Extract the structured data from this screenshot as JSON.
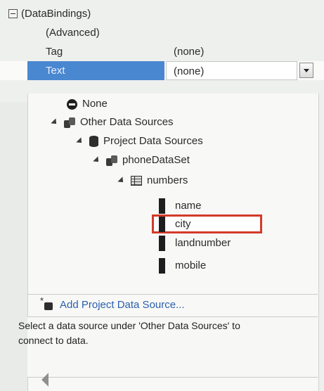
{
  "grid": {
    "category": "(DataBindings)",
    "rows": [
      {
        "label": "(Advanced)",
        "value": ""
      },
      {
        "label": "Tag",
        "value": "(none)"
      },
      {
        "label": "Text",
        "value": "(none)"
      }
    ]
  },
  "dropdown": {
    "none_label": "None",
    "tree": {
      "other": "Other Data Sources",
      "project": "Project Data Sources",
      "dataset": "phoneDataSet",
      "table": "numbers",
      "fields": [
        "name",
        "city",
        "landnumber",
        "mobile"
      ]
    },
    "add_link": "Add Project Data Source...",
    "description": "Select a data source under 'Other Data Sources' to connect to data."
  },
  "colors": {
    "selection": "#4a87d1",
    "highlight_border": "#d43a2a",
    "link": "#2a5fae"
  },
  "icons": [
    "expander-minus-icon",
    "none-icon",
    "data-source-icon",
    "database-icon",
    "table-icon",
    "field-icon",
    "add-data-source-icon",
    "dropdown-arrow-icon",
    "resize-grip-icon"
  ]
}
